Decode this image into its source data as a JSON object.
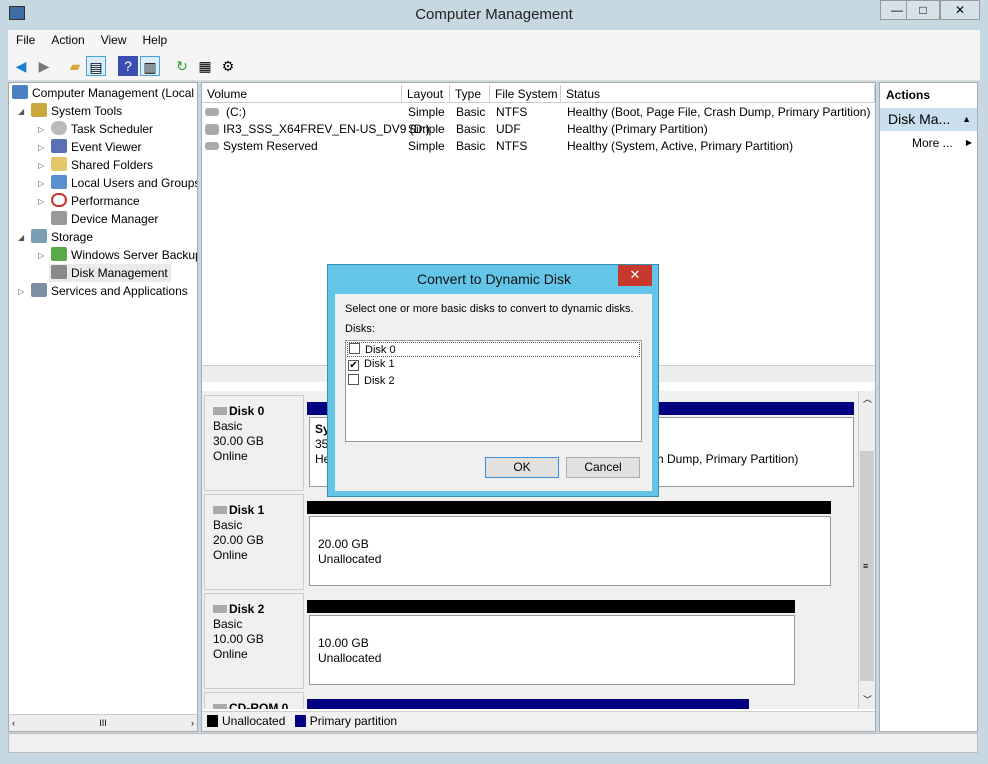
{
  "window": {
    "title": "Computer Management",
    "min": "—",
    "max": "□",
    "close": "✕"
  },
  "menu": [
    "File",
    "Action",
    "View",
    "Help"
  ],
  "toolbar": [
    "back-icon",
    "forward-icon",
    "up-folder-icon",
    "show-hide-tree-icon",
    "help-icon",
    "show-hide-action-pane-icon",
    "refresh-icon",
    "properties-icon",
    "settings-icon"
  ],
  "tree": {
    "root": "Computer Management (Local",
    "items": [
      "System Tools",
      "Task Scheduler",
      "Event Viewer",
      "Shared Folders",
      "Local Users and Groups",
      "Performance",
      "Device Manager",
      "Storage",
      "Windows Server Backup",
      "Disk Management",
      "Services and Applications"
    ],
    "hscroll": "III"
  },
  "volumes": {
    "headers": [
      "Volume",
      "Layout",
      "Type",
      "File System",
      "Status"
    ],
    "rows": [
      [
        "(C:)",
        "Simple",
        "Basic",
        "NTFS",
        "Healthy (Boot, Page File, Crash Dump, Primary Partition)"
      ],
      [
        "IR3_SSS_X64FREV_EN-US_DV9 (D:)",
        "Simple",
        "Basic",
        "UDF",
        "Healthy (Primary Partition)"
      ],
      [
        "System Reserved",
        "Simple",
        "Basic",
        "NTFS",
        "Healthy (System, Active, Primary Partition)"
      ]
    ]
  },
  "disks": [
    {
      "name": "Disk 0",
      "type": "Basic",
      "size": "30.00 GB",
      "state": "Online",
      "part_title": "Sy",
      "part_size": "35",
      "part_status": "He",
      "part_status_tail": "sh Dump, Primary Partition)"
    },
    {
      "name": "Disk 1",
      "type": "Basic",
      "size": "20.00 GB",
      "state": "Online",
      "part_size": "20.00 GB",
      "part_status": "Unallocated"
    },
    {
      "name": "Disk 2",
      "type": "Basic",
      "size": "10.00 GB",
      "state": "Online",
      "part_size": "10.00 GB",
      "part_status": "Unallocated"
    },
    {
      "name": "CD-ROM 0"
    }
  ],
  "legend": [
    {
      "label": "Unallocated",
      "color": "#000000"
    },
    {
      "label": "Primary partition",
      "color": "#000080"
    }
  ],
  "actions": {
    "header": "Actions",
    "section": "Disk Ma...",
    "more": "More ..."
  },
  "dialog": {
    "title": "Convert to Dynamic Disk",
    "instruction": "Select one or more basic disks to convert to dynamic disks.",
    "disks_label": "Disks:",
    "disks": [
      {
        "label": "Disk 0",
        "checked": false
      },
      {
        "label": "Disk 1",
        "checked": true
      },
      {
        "label": "Disk 2",
        "checked": false
      }
    ],
    "ok": "OK",
    "cancel": "Cancel",
    "check_mark": "✔"
  }
}
